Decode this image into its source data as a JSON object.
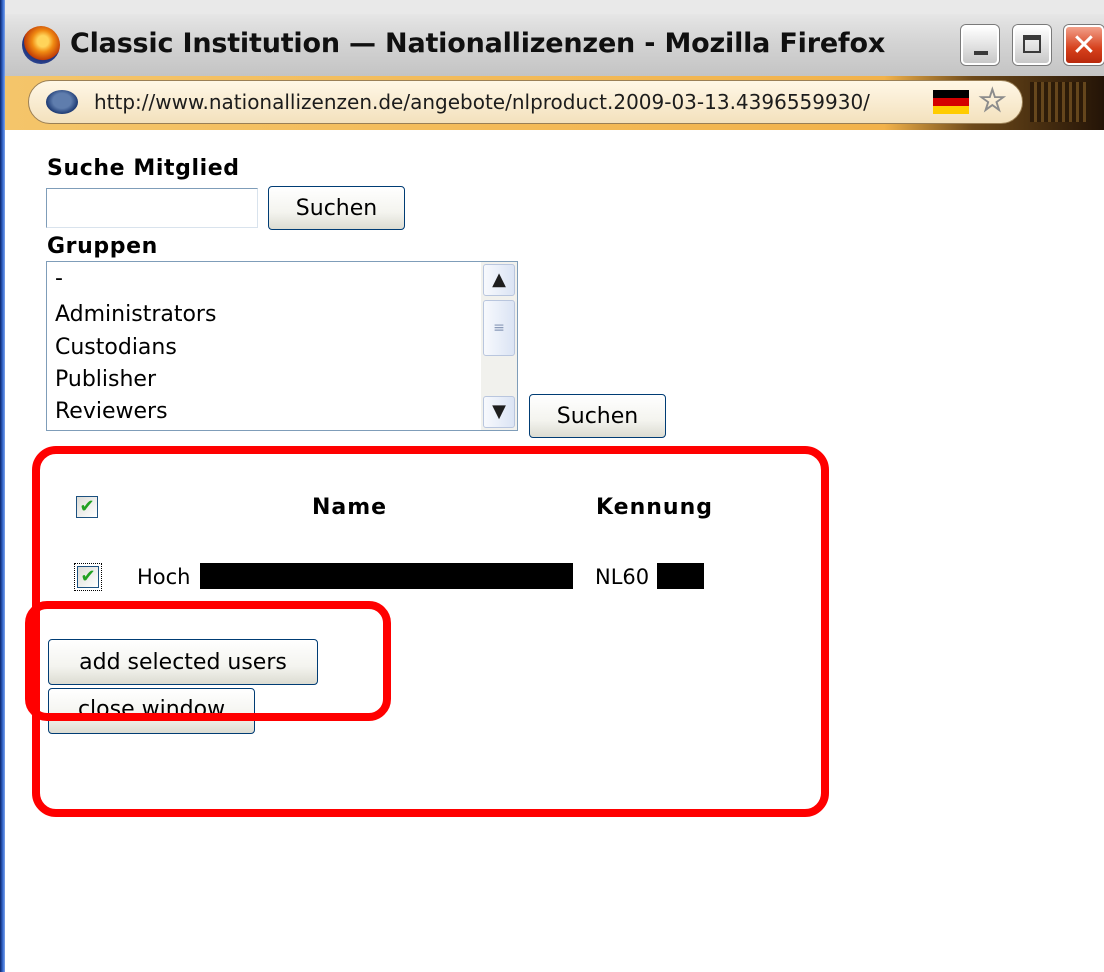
{
  "window": {
    "title": "Classic Institution — Nationallizenzen - Mozilla Firefox",
    "close_glyph": "✕"
  },
  "addressbar": {
    "url": "http://www.nationallizenzen.de/angebote/nlproduct.2009-03-13.4396559930/",
    "star_glyph": "☆"
  },
  "search": {
    "label": "Suche Mitglied",
    "input_value": "",
    "button_label": "Suchen"
  },
  "groups": {
    "label": "Gruppen",
    "options": [
      "-",
      "Administrators",
      "Custodians",
      "Publisher",
      "Reviewers"
    ],
    "button_label": "Suchen",
    "scroll_up": "▲",
    "scroll_down": "▼",
    "scroll_grip": "≡"
  },
  "results": {
    "header_checked": true,
    "columns": {
      "name": "Name",
      "kennung": "Kennung"
    },
    "rows": [
      {
        "checked": true,
        "name_visible": "Hoch",
        "kennung_visible": "NL60"
      }
    ],
    "check_glyph": "✔"
  },
  "actions": {
    "add_label": "add selected users",
    "close_label": "close window"
  },
  "colors": {
    "highlight": "#ff0000",
    "accent_button_border": "#003c74"
  }
}
